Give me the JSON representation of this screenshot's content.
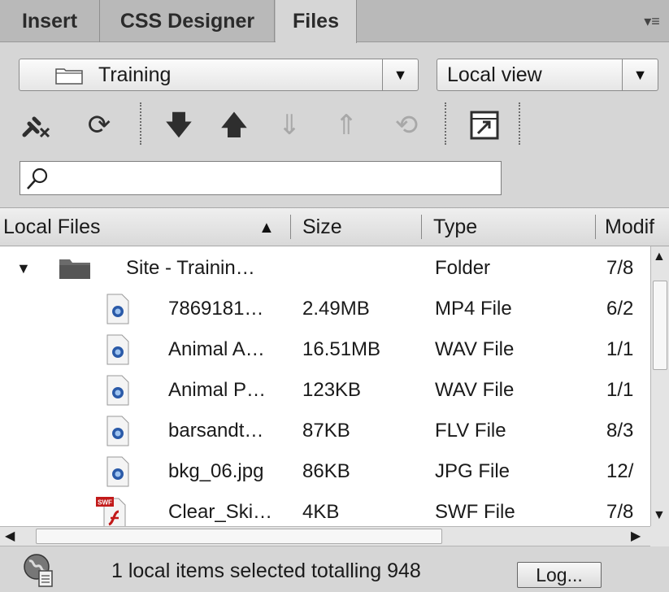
{
  "tabs": [
    {
      "label": "Insert"
    },
    {
      "label": "CSS Designer"
    },
    {
      "label": "Files"
    }
  ],
  "tab_menu_icon": "panel-menu-icon",
  "site_select": {
    "value": "Training"
  },
  "view_select": {
    "value": "Local view"
  },
  "toolbar": {
    "icons": [
      "disconnect-icon",
      "refresh-icon",
      "get-files-icon",
      "put-files-icon",
      "check-out-icon",
      "check-in-icon",
      "synchronize-icon",
      "expand-panel-icon"
    ]
  },
  "search": {
    "placeholder": "",
    "value": ""
  },
  "columns": [
    {
      "label": "Local Files"
    },
    {
      "label": "Size"
    },
    {
      "label": "Type"
    },
    {
      "label": "Modif"
    }
  ],
  "files": [
    {
      "name": "Site - Trainin…",
      "size": "",
      "type": "Folder",
      "modified": "7/8",
      "icon": "folder-icon"
    },
    {
      "name": "7869181…",
      "size": "2.49MB",
      "type": "MP4 File",
      "modified": "6/2",
      "icon": "quicktime-file-icon"
    },
    {
      "name": "Animal A…",
      "size": "16.51MB",
      "type": "WAV File",
      "modified": "1/1",
      "icon": "quicktime-file-icon"
    },
    {
      "name": "Animal P…",
      "size": "123KB",
      "type": "WAV File",
      "modified": "1/1",
      "icon": "quicktime-file-icon"
    },
    {
      "name": "barsandt…",
      "size": "87KB",
      "type": "FLV File",
      "modified": "8/3",
      "icon": "quicktime-file-icon"
    },
    {
      "name": "bkg_06.jpg",
      "size": "86KB",
      "type": "JPG File",
      "modified": "12/",
      "icon": "quicktime-file-icon"
    },
    {
      "name": "Clear_Ski…",
      "size": "4KB",
      "type": "SWF File",
      "modified": "7/8",
      "icon": "swf-file-icon",
      "badge": "SWF"
    }
  ],
  "status": {
    "text": "1 local items selected totalling 948",
    "log_label": "Log..."
  },
  "colors": {
    "background": "#d6d6d6",
    "tab_inactive": "#b9b9b9",
    "list_bg": "#ffffff"
  }
}
